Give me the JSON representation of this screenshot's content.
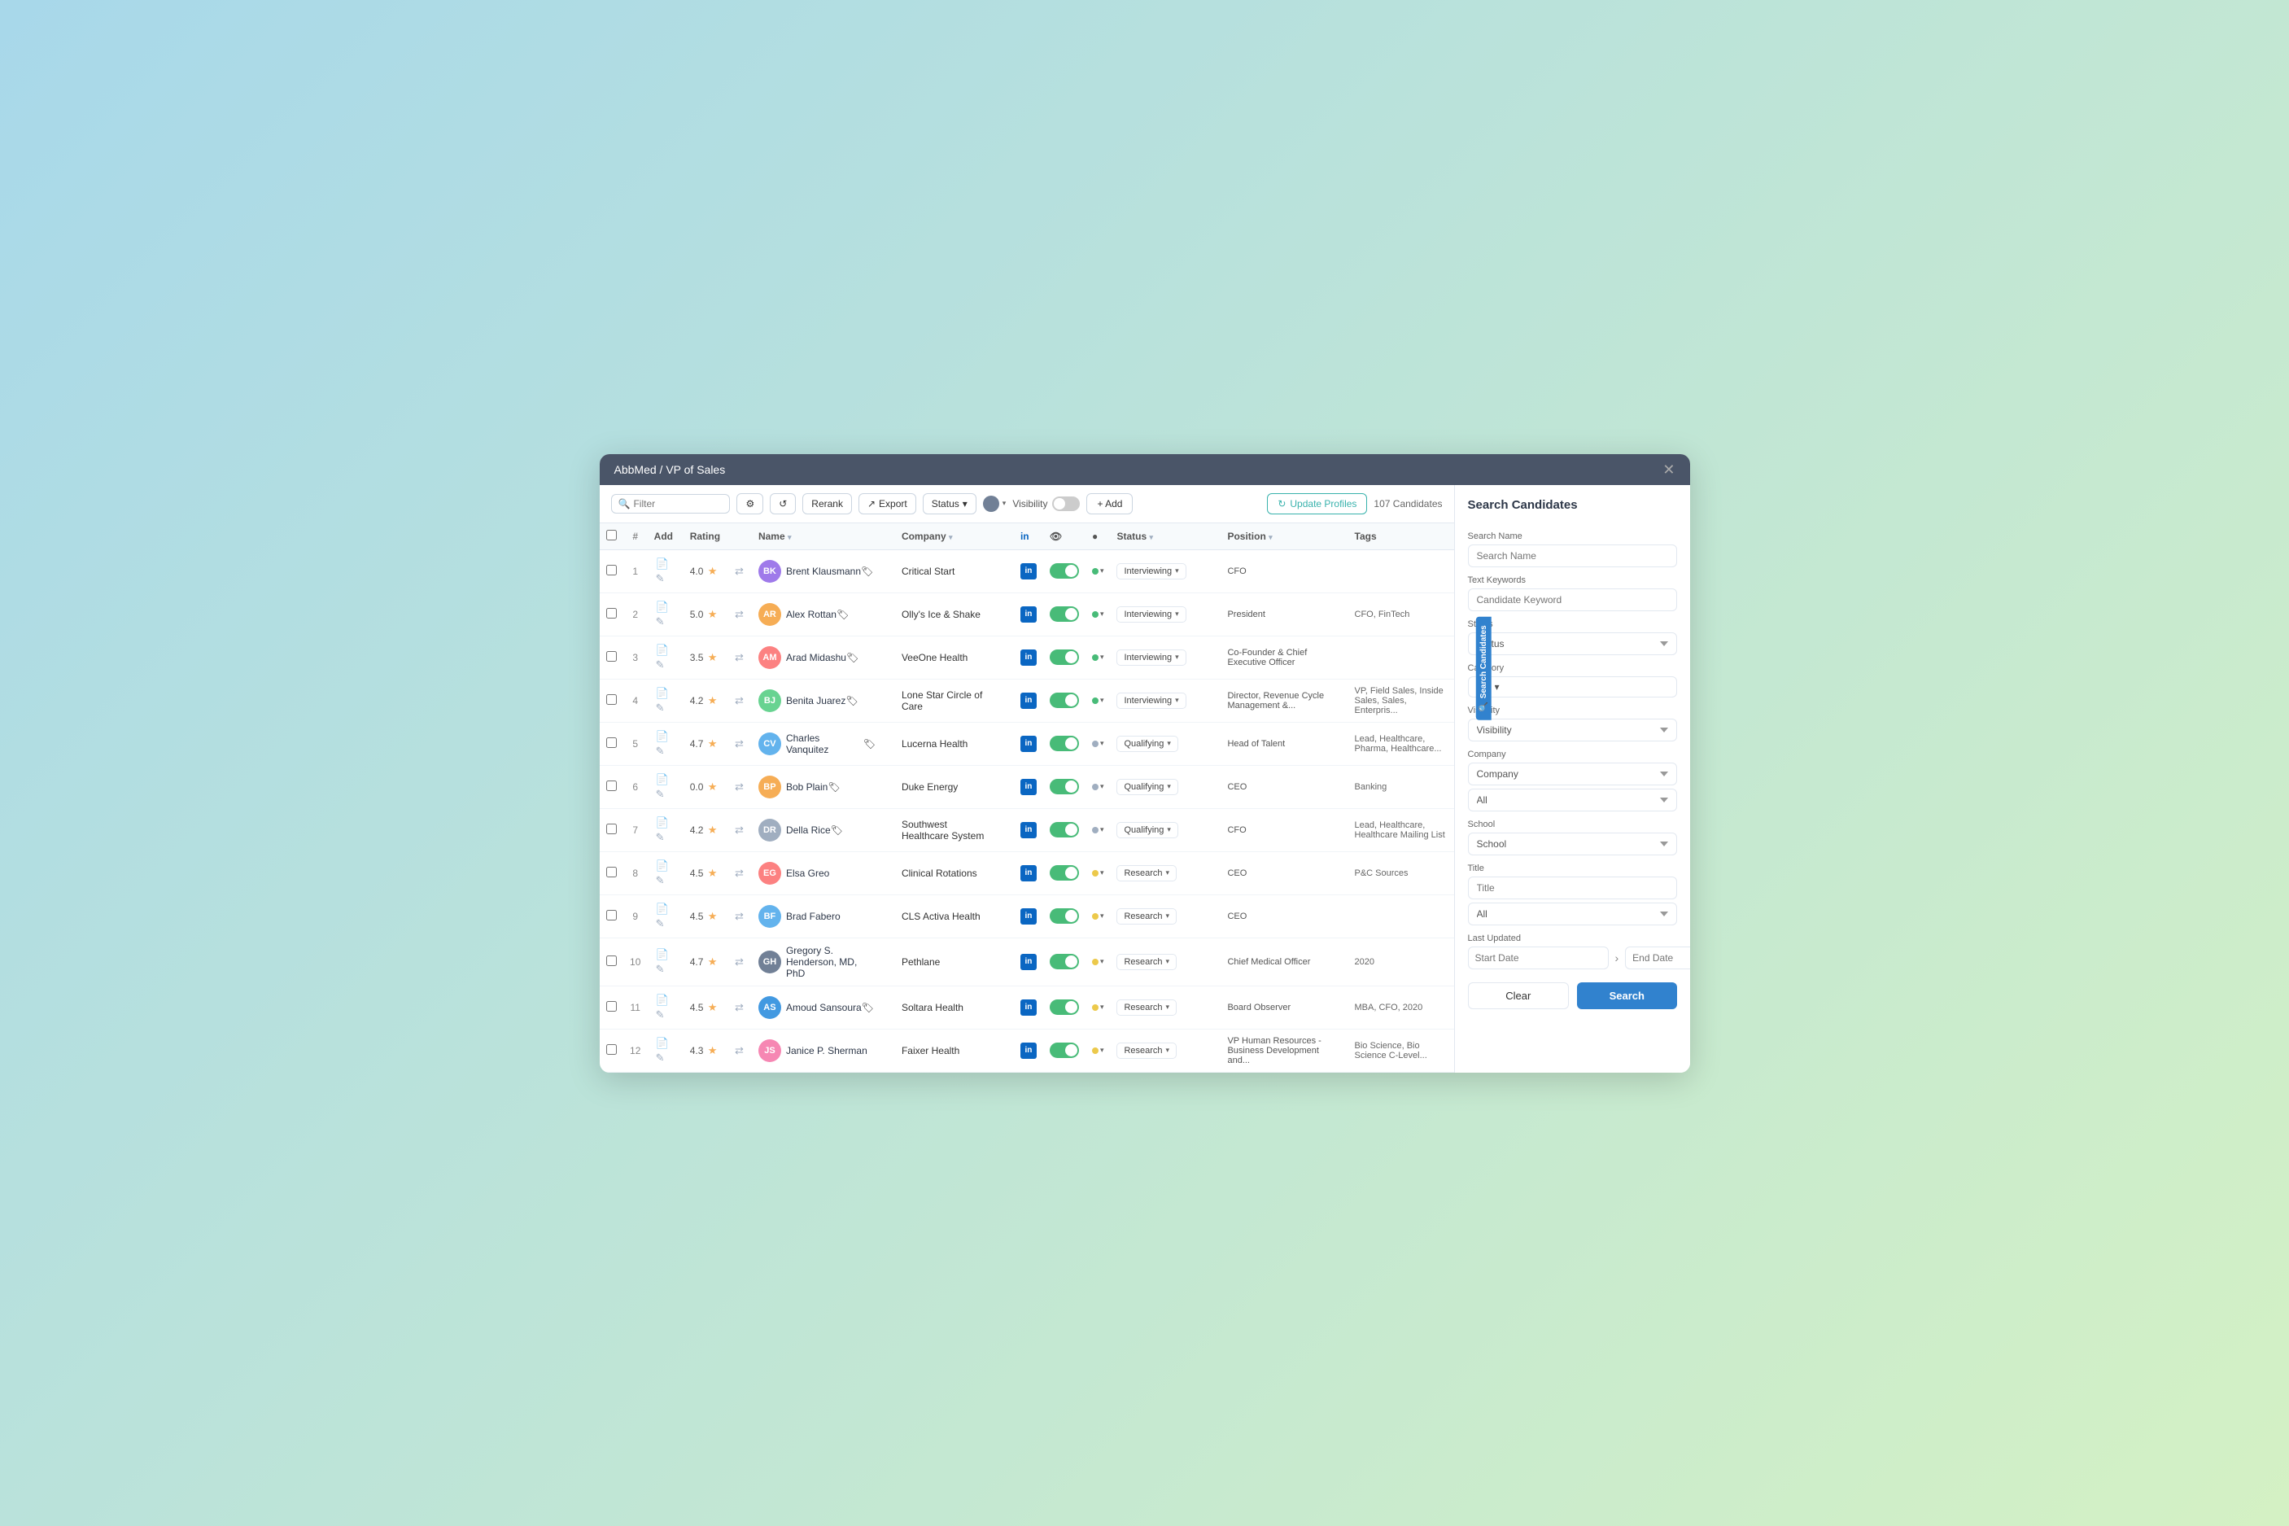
{
  "window": {
    "title": "AbbMed / VP of Sales",
    "close_label": "✕"
  },
  "toolbar": {
    "filter_placeholder": "Filter",
    "rerank_label": "Rerank",
    "export_label": "Export",
    "status_label": "Status",
    "add_label": "+ Add",
    "update_label": "Update Profiles",
    "visibility_label": "Visibility",
    "candidate_count": "107 Candidates"
  },
  "table": {
    "columns": [
      "",
      "#",
      "Add",
      "Rating",
      "",
      "Name",
      "",
      "Company",
      "",
      "Li",
      "👁",
      "●",
      "Status",
      "",
      "Position",
      "",
      "Tags"
    ],
    "rows": [
      {
        "id": 1,
        "rating": "4.0",
        "name": "Brent Klausmann",
        "company": "Critical Start",
        "status": "Interviewing",
        "position": "CFO",
        "tags": "",
        "dot": "green",
        "avatar_color": "#9f7aea",
        "initials": "BK"
      },
      {
        "id": 2,
        "rating": "5.0",
        "name": "Alex Rottan",
        "company": "Olly's Ice & Shake",
        "status": "Interviewing",
        "position": "President",
        "tags": "CFO, FinTech",
        "dot": "green",
        "avatar_color": "#f6ad55",
        "initials": "AR"
      },
      {
        "id": 3,
        "rating": "3.5",
        "name": "Arad Midashu",
        "company": "VeeOne Health",
        "status": "Interviewing",
        "position": "Co-Founder & Chief Executive Officer",
        "tags": "",
        "dot": "green",
        "avatar_color": "#fc8181",
        "initials": "AM"
      },
      {
        "id": 4,
        "rating": "4.2",
        "name": "Benita Juarez",
        "company": "Lone Star Circle of Care",
        "status": "Interviewing",
        "position": "Director, Revenue Cycle Management &...",
        "tags": "VP, Field Sales, Inside Sales, Sales, Enterpris...",
        "dot": "green",
        "avatar_color": "#68d391",
        "initials": "BJ"
      },
      {
        "id": 5,
        "rating": "4.7",
        "name": "Charles Vanquitez",
        "company": "Lucerna Health",
        "status": "Qualifying",
        "position": "Head of Talent",
        "tags": "Lead, Healthcare, Pharma, Healthcare...",
        "dot": "gray",
        "avatar_color": "#63b3ed",
        "initials": "CV"
      },
      {
        "id": 6,
        "rating": "0.0",
        "name": "Bob Plain",
        "company": "Duke Energy",
        "status": "Qualifying",
        "position": "CEO",
        "tags": "Banking",
        "dot": "gray",
        "avatar_color": "#f6ad55",
        "initials": "BP"
      },
      {
        "id": 7,
        "rating": "4.2",
        "name": "Della Rice",
        "company": "Southwest Healthcare System",
        "status": "Qualifying",
        "position": "CFO",
        "tags": "Lead, Healthcare, Healthcare Mailing List",
        "dot": "gray",
        "avatar_color": "#a0aec0",
        "initials": "DR"
      },
      {
        "id": 8,
        "rating": "4.5",
        "name": "Elsa Greo",
        "company": "Clinical Rotations",
        "status": "Research",
        "position": "CEO",
        "tags": "P&C Sources",
        "dot": "yellow",
        "avatar_color": "#fc8181",
        "initials": "EG"
      },
      {
        "id": 9,
        "rating": "4.5",
        "name": "Brad Fabero",
        "company": "CLS Activa Health",
        "status": "Research",
        "position": "CEO",
        "tags": "",
        "dot": "yellow",
        "avatar_color": "#63b3ed",
        "initials": "BF"
      },
      {
        "id": 10,
        "rating": "4.7",
        "name": "Gregory S. Henderson, MD, PhD",
        "company": "Pethlane",
        "status": "Research",
        "position": "Chief Medical Officer",
        "tags": "2020",
        "dot": "yellow",
        "avatar_color": "#718096",
        "initials": "GH"
      },
      {
        "id": 11,
        "rating": "4.5",
        "name": "Amoud Sansoura",
        "company": "Soltara Health",
        "status": "Research",
        "position": "Board Observer",
        "tags": "MBA, CFO, 2020",
        "dot": "yellow",
        "avatar_color": "#4299e1",
        "initials": "AS"
      },
      {
        "id": 12,
        "rating": "4.3",
        "name": "Janice P. Sherman",
        "company": "Faixer Health",
        "status": "Research",
        "position": "VP Human Resources - Business Development and...",
        "tags": "Bio Science, Bio Science C-Level...",
        "dot": "yellow",
        "avatar_color": "#f687b3",
        "initials": "JS"
      }
    ]
  },
  "search_panel": {
    "title": "Search Candidates",
    "tab_label": "Search Candidates",
    "search_name_label": "Search Name",
    "search_name_placeholder": "Search Name",
    "text_keywords_label": "Text Keywords",
    "text_keywords_placeholder": "Candidate Keyword",
    "status_label": "Status",
    "status_placeholder": "Status",
    "category_label": "Category",
    "visibility_label": "Visibility",
    "visibility_placeholder": "Visibility",
    "company_label": "Company",
    "company_placeholder": "Company",
    "all_label": "All",
    "school_label": "School",
    "school_placeholder": "School",
    "title_label": "Title",
    "title_placeholder": "Title",
    "title_all_label": "All",
    "last_updated_label": "Last Updated",
    "start_date_placeholder": "Start Date",
    "end_date_placeholder": "End Date",
    "clear_label": "Clear",
    "search_label": "Search"
  }
}
